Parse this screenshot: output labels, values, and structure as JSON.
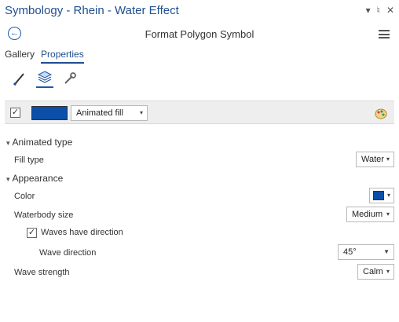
{
  "window": {
    "title": "Symbology - Rhein - Water Effect",
    "pin_icon": "pin-icon",
    "close_icon": "close-icon",
    "controls": [
      "▾",
      "♮",
      "✕"
    ]
  },
  "header": {
    "back_icon": "back-arrow-icon",
    "back_glyph": "←",
    "title": "Format Polygon Symbol",
    "menu_icon": "hamburger-menu-icon"
  },
  "tabs": [
    {
      "label": "Gallery",
      "active": false
    },
    {
      "label": "Properties",
      "active": true
    }
  ],
  "property_pages": [
    {
      "icon": "paintbrush-icon",
      "active": false
    },
    {
      "icon": "layers-icon",
      "active": true
    },
    {
      "icon": "wrench-icon",
      "active": false
    }
  ],
  "layer": {
    "checked": true,
    "check_glyph": "✓",
    "swatch_color": "#0b4fa8",
    "type": "Animated fill",
    "palette_icon": "color-palette-icon"
  },
  "sections": {
    "animated_type": {
      "title": "Animated type",
      "fill_type_label": "Fill type",
      "fill_type_value": "Water"
    },
    "appearance": {
      "title": "Appearance",
      "color_label": "Color",
      "color_value": "#0b4fa8",
      "waterbody_size_label": "Waterbody size",
      "waterbody_size_value": "Medium",
      "waves_direction_label": "Waves have direction",
      "waves_direction_checked": true,
      "wave_direction_label": "Wave direction",
      "wave_direction_value": "45°",
      "wave_strength_label": "Wave strength",
      "wave_strength_value": "Calm"
    }
  },
  "glyphs": {
    "expand": "❯",
    "dropdown": "▾",
    "dropdown_solid": "▼"
  }
}
